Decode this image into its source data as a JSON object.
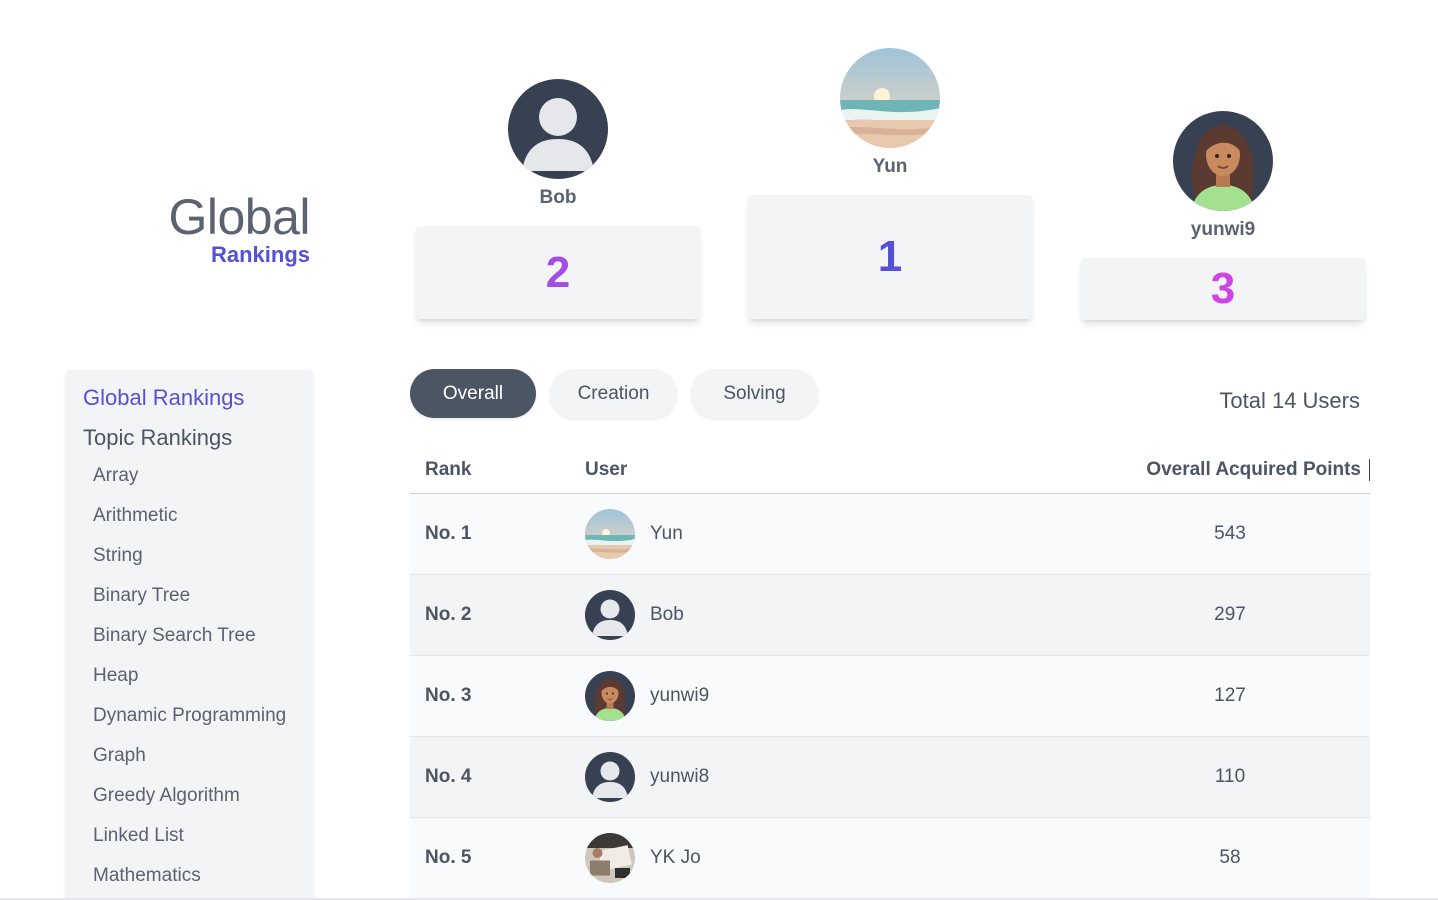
{
  "heading": {
    "title": "Global",
    "subtitle": "Rankings"
  },
  "podium": {
    "first": {
      "name": "Yun",
      "rank": "1",
      "avatar": "beach-photo-avatar"
    },
    "second": {
      "name": "Bob",
      "rank": "2",
      "avatar": "default-user-avatar"
    },
    "third": {
      "name": "yunwi9",
      "rank": "3",
      "avatar": "woman-illustration-avatar"
    }
  },
  "sidebar": {
    "global_label": "Global Rankings",
    "topic_label": "Topic Rankings",
    "topics": [
      "Array",
      "Arithmetic",
      "String",
      "Binary Tree",
      "Binary Search Tree",
      "Heap",
      "Dynamic Programming",
      "Graph",
      "Greedy Algorithm",
      "Linked List",
      "Mathematics"
    ]
  },
  "tabs": [
    {
      "label": "Overall",
      "active": true
    },
    {
      "label": "Creation",
      "active": false
    },
    {
      "label": "Solving",
      "active": false
    }
  ],
  "total_users": "Total 14 Users",
  "table": {
    "headers": {
      "rank": "Rank",
      "user": "User",
      "points": "Overall Acquired Points"
    },
    "rows": [
      {
        "rank": "No. 1",
        "user": "Yun",
        "points": "543",
        "avatar": "beach-photo-avatar"
      },
      {
        "rank": "No. 2",
        "user": "Bob",
        "points": "297",
        "avatar": "default-user-avatar"
      },
      {
        "rank": "No. 3",
        "user": "yunwi9",
        "points": "127",
        "avatar": "woman-illustration-avatar"
      },
      {
        "rank": "No. 4",
        "user": "yunwi8",
        "points": "110",
        "avatar": "default-user-avatar"
      },
      {
        "rank": "No. 5",
        "user": "YK Jo",
        "points": "58",
        "avatar": "desk-photo-avatar"
      }
    ]
  },
  "colors": {
    "accent": "#5650d6",
    "rank2": "#a44de3",
    "rank3": "#d044e6",
    "dark": "#4b5563",
    "panel": "#f3f4f6"
  }
}
